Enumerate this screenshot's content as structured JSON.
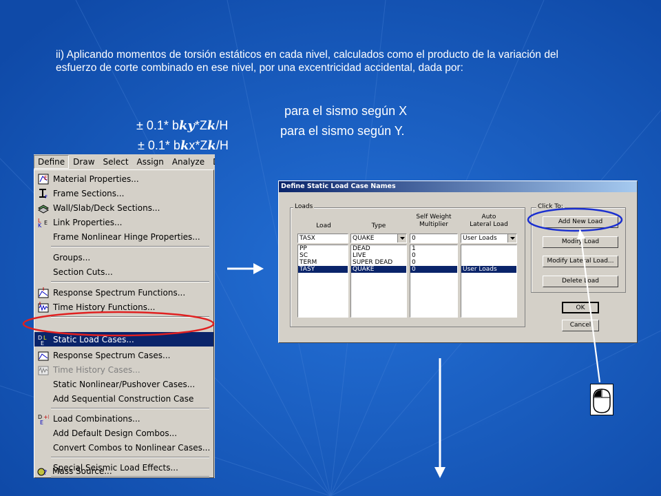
{
  "slide": {
    "intro": "ii) Aplicando momentos de torsión estáticos en cada nivel, calculados como el producto de la variación del esfuerzo de corte combinado en ese nivel, por una excentricidad accidental, dada por:",
    "formula_x": {
      "prefix": "± 0.1* b",
      "sym1": "k",
      "sym2": "y",
      "mid": "*Z",
      "sym3": "k",
      "suffix": "/H",
      "desc": "para el sismo según X"
    },
    "formula_y": {
      "prefix": "± 0.1* b",
      "sym1": "k",
      "mid": "x*Z",
      "sym2": "k",
      "suffix": "/H",
      "desc": "para el sismo según Y."
    }
  },
  "menubar": [
    "Define",
    "Draw",
    "Select",
    "Assign",
    "Analyze",
    "D"
  ],
  "menu": {
    "items": [
      {
        "label": "Material Properties...",
        "icon": "material-icon"
      },
      {
        "label": "Frame Sections...",
        "icon": "frame-section-icon"
      },
      {
        "label": "Wall/Slab/Deck Sections...",
        "icon": "wall-slab-deck-icon"
      },
      {
        "label": "Link Properties...",
        "icon": "link-icon"
      },
      {
        "label": "Frame Nonlinear Hinge Properties...",
        "icon": ""
      },
      {
        "label": "Groups...",
        "icon": ""
      },
      {
        "label": "Section Cuts...",
        "icon": ""
      },
      {
        "label": "Response Spectrum Functions...",
        "icon": "response-spectrum-function-icon"
      },
      {
        "label": "Time History Functions...",
        "icon": "time-history-function-icon"
      },
      {
        "label": "Static Load Cases...",
        "icon": "static-load-case-icon"
      },
      {
        "label": "Response Spectrum Cases...",
        "icon": "response-spectrum-case-icon"
      },
      {
        "label": "Time History Cases...",
        "icon": "time-history-case-icon"
      },
      {
        "label": "Static Nonlinear/Pushover Cases...",
        "icon": ""
      },
      {
        "label": "Add Sequential Construction Case",
        "icon": ""
      },
      {
        "label": "Load Combinations...",
        "icon": "load-combination-icon"
      },
      {
        "label": "Add Default Design Combos...",
        "icon": ""
      },
      {
        "label": "Convert Combos to Nonlinear Cases...",
        "icon": ""
      },
      {
        "label": "Special Seismic Load Effects...",
        "icon": ""
      },
      {
        "label": "Mass Source...",
        "icon": "mass-source-icon"
      }
    ]
  },
  "dialog": {
    "title": "Define Static Load Case Names",
    "loads_group": "Loads",
    "col_load": "Load",
    "col_type": "Type",
    "col_self_weight": "Self Weight\nMultiplier",
    "col_auto_lateral": "Auto\nLateral Load",
    "input_load": "TASX",
    "input_type": "QUAKE",
    "input_self_weight": "0",
    "input_auto_lateral": "User Loads",
    "rows": [
      {
        "load": "PP",
        "type": "DEAD",
        "mult": "1",
        "auto": ""
      },
      {
        "load": "SC",
        "type": "LIVE",
        "mult": "0",
        "auto": ""
      },
      {
        "load": "TERM",
        "type": "SUPER DEAD",
        "mult": "0",
        "auto": ""
      },
      {
        "load": "TASY",
        "type": "QUAKE",
        "mult": "0",
        "auto": "User Loads"
      }
    ],
    "click_group": "Click To:",
    "btn_add": "Add New Load",
    "btn_modify": "Modify Load",
    "btn_modify_lateral": "Modify Lateral Load...",
    "btn_delete": "Delete Load",
    "btn_ok": "OK",
    "btn_cancel": "Cancel"
  },
  "colors": {
    "background": "#1a5fc0",
    "highlight_ellipse": "#e02020",
    "button_circle": "#1a2fd0",
    "selection": "#0a246a"
  }
}
